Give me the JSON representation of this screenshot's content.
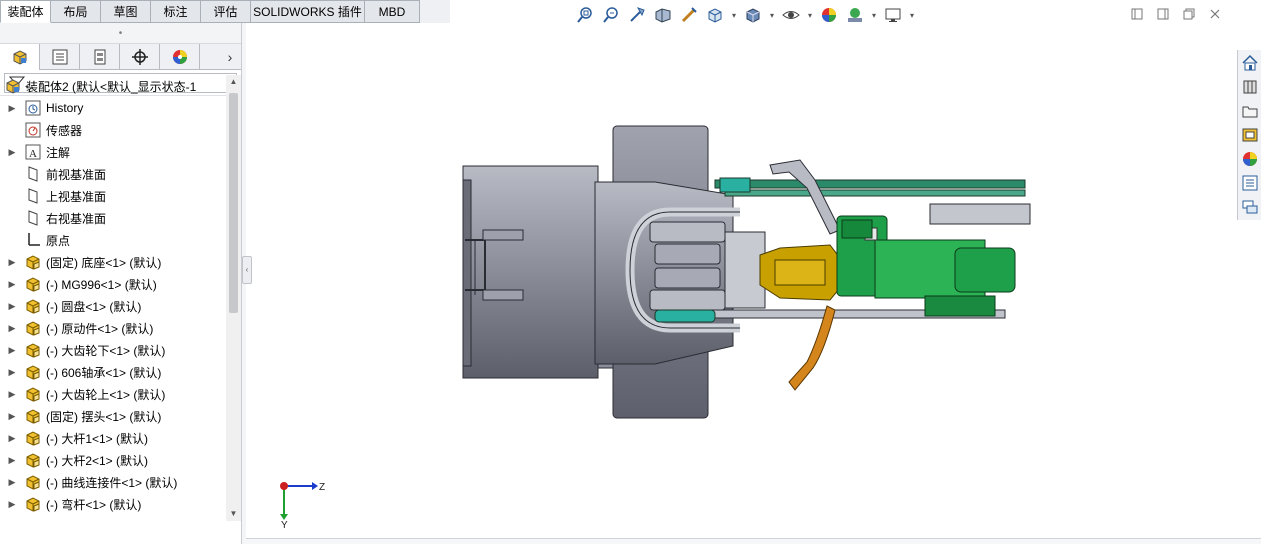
{
  "tabs": [
    {
      "label": "装配体",
      "active": true,
      "width": 51
    },
    {
      "label": "布局",
      "active": false,
      "width": 50
    },
    {
      "label": "草图",
      "active": false,
      "width": 50
    },
    {
      "label": "标注",
      "active": false,
      "width": 50
    },
    {
      "label": "评估",
      "active": false,
      "width": 50
    },
    {
      "label": "SOLIDWORKS 插件",
      "active": false,
      "width": 114
    },
    {
      "label": "MBD",
      "active": false,
      "width": 55
    }
  ],
  "manager_tabs": [
    "featuremanager-icon",
    "propertymanager-icon",
    "configurationmanager-icon",
    "dimxpert-icon",
    "display-manager-icon"
  ],
  "tree": {
    "root": {
      "label": "装配体2 (默认<默认_显示状态-1"
    },
    "items": [
      {
        "label": "History",
        "icon": "history-icon",
        "expandable": true
      },
      {
        "label": "传感器",
        "icon": "sensor-icon",
        "expandable": false
      },
      {
        "label": "注解",
        "icon": "annotation-icon",
        "expandable": true
      },
      {
        "label": "前视基准面",
        "icon": "plane-icon",
        "expandable": false
      },
      {
        "label": "上视基准面",
        "icon": "plane-icon",
        "expandable": false
      },
      {
        "label": "右视基准面",
        "icon": "plane-icon",
        "expandable": false
      },
      {
        "label": "原点",
        "icon": "origin-icon",
        "expandable": false
      },
      {
        "label": "(固定) 底座<1> (默认)",
        "icon": "part-icon",
        "expandable": true
      },
      {
        "label": "(-) MG996<1> (默认)",
        "icon": "part-icon",
        "expandable": true
      },
      {
        "label": "(-) 圆盘<1> (默认)",
        "icon": "part-icon",
        "expandable": true
      },
      {
        "label": "(-) 原动件<1> (默认)",
        "icon": "part-icon",
        "expandable": true
      },
      {
        "label": "(-) 大齿轮下<1> (默认)",
        "icon": "part-icon",
        "expandable": true
      },
      {
        "label": "(-) 606轴承<1> (默认)",
        "icon": "part-icon",
        "expandable": true
      },
      {
        "label": "(-) 大齿轮上<1> (默认)",
        "icon": "part-icon",
        "expandable": true
      },
      {
        "label": "(固定) 摆头<1> (默认)",
        "icon": "part-icon",
        "expandable": true
      },
      {
        "label": "(-) 大杆1<1> (默认)",
        "icon": "part-icon",
        "expandable": true
      },
      {
        "label": "(-) 大杆2<1> (默认)",
        "icon": "part-icon",
        "expandable": true
      },
      {
        "label": "(-) 曲线连接件<1> (默认)",
        "icon": "part-icon",
        "expandable": true
      },
      {
        "label": "(-) 弯杆<1> (默认)",
        "icon": "part-icon",
        "expandable": true
      }
    ]
  },
  "triad": {
    "z_label": "Z",
    "y_label": "Y"
  },
  "colors": {
    "gray_part": "#8c8f99",
    "green_part": "#1ea04a",
    "teal_part": "#2aa89a",
    "yellow_part": "#c8a000",
    "orange_part": "#d4861c"
  }
}
